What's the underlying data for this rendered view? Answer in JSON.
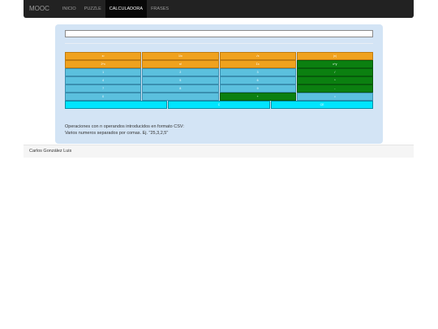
{
  "navbar": {
    "brand": "MOOC",
    "items": [
      {
        "label": "INICIO"
      },
      {
        "label": "PUZZLE"
      },
      {
        "label": "CALCULADORA"
      },
      {
        "label": "FRASES"
      }
    ]
  },
  "calculator": {
    "display_value": "",
    "rows": [
      [
        {
          "label": "x²",
          "color": "orange"
        },
        {
          "label": "1/x",
          "color": "orange"
        },
        {
          "label": "√x",
          "color": "orange"
        },
        {
          "label": "|x|",
          "color": "orange"
        }
      ],
      [
        {
          "label": "2^x",
          "color": "orange"
        },
        {
          "label": "n!",
          "color": "orange"
        },
        {
          "label": "Σx",
          "color": "orange"
        },
        {
          "label": "x^y",
          "color": "green"
        }
      ],
      [
        {
          "label": "1",
          "color": "blue"
        },
        {
          "label": "2",
          "color": "blue"
        },
        {
          "label": "3",
          "color": "blue"
        },
        {
          "label": "/",
          "color": "green"
        }
      ],
      [
        {
          "label": "4",
          "color": "blue"
        },
        {
          "label": "5",
          "color": "blue"
        },
        {
          "label": "6",
          "color": "blue"
        },
        {
          "label": "*",
          "color": "green"
        }
      ],
      [
        {
          "label": "7",
          "color": "blue"
        },
        {
          "label": "8",
          "color": "blue"
        },
        {
          "label": "9",
          "color": "blue"
        },
        {
          "label": "-",
          "color": "green"
        }
      ],
      [
        {
          "label": "0",
          "color": "blue"
        },
        {
          "label": "",
          "color": "blue"
        },
        {
          "label": "+",
          "color": "green"
        },
        {
          "label": "=",
          "color": "blue"
        }
      ],
      [
        {
          "label": "",
          "color": "cyan"
        },
        {
          "label": "C",
          "color": "cyan"
        },
        {
          "label": "CE",
          "color": "cyan"
        }
      ]
    ]
  },
  "help": {
    "line1": "Operaciones con n operandos introducidos en formato CSV:",
    "line2": "Varios numeros separados por comas. Ej. \"25,3,2,5\""
  },
  "footer": {
    "author": "Carlos González Luis"
  }
}
